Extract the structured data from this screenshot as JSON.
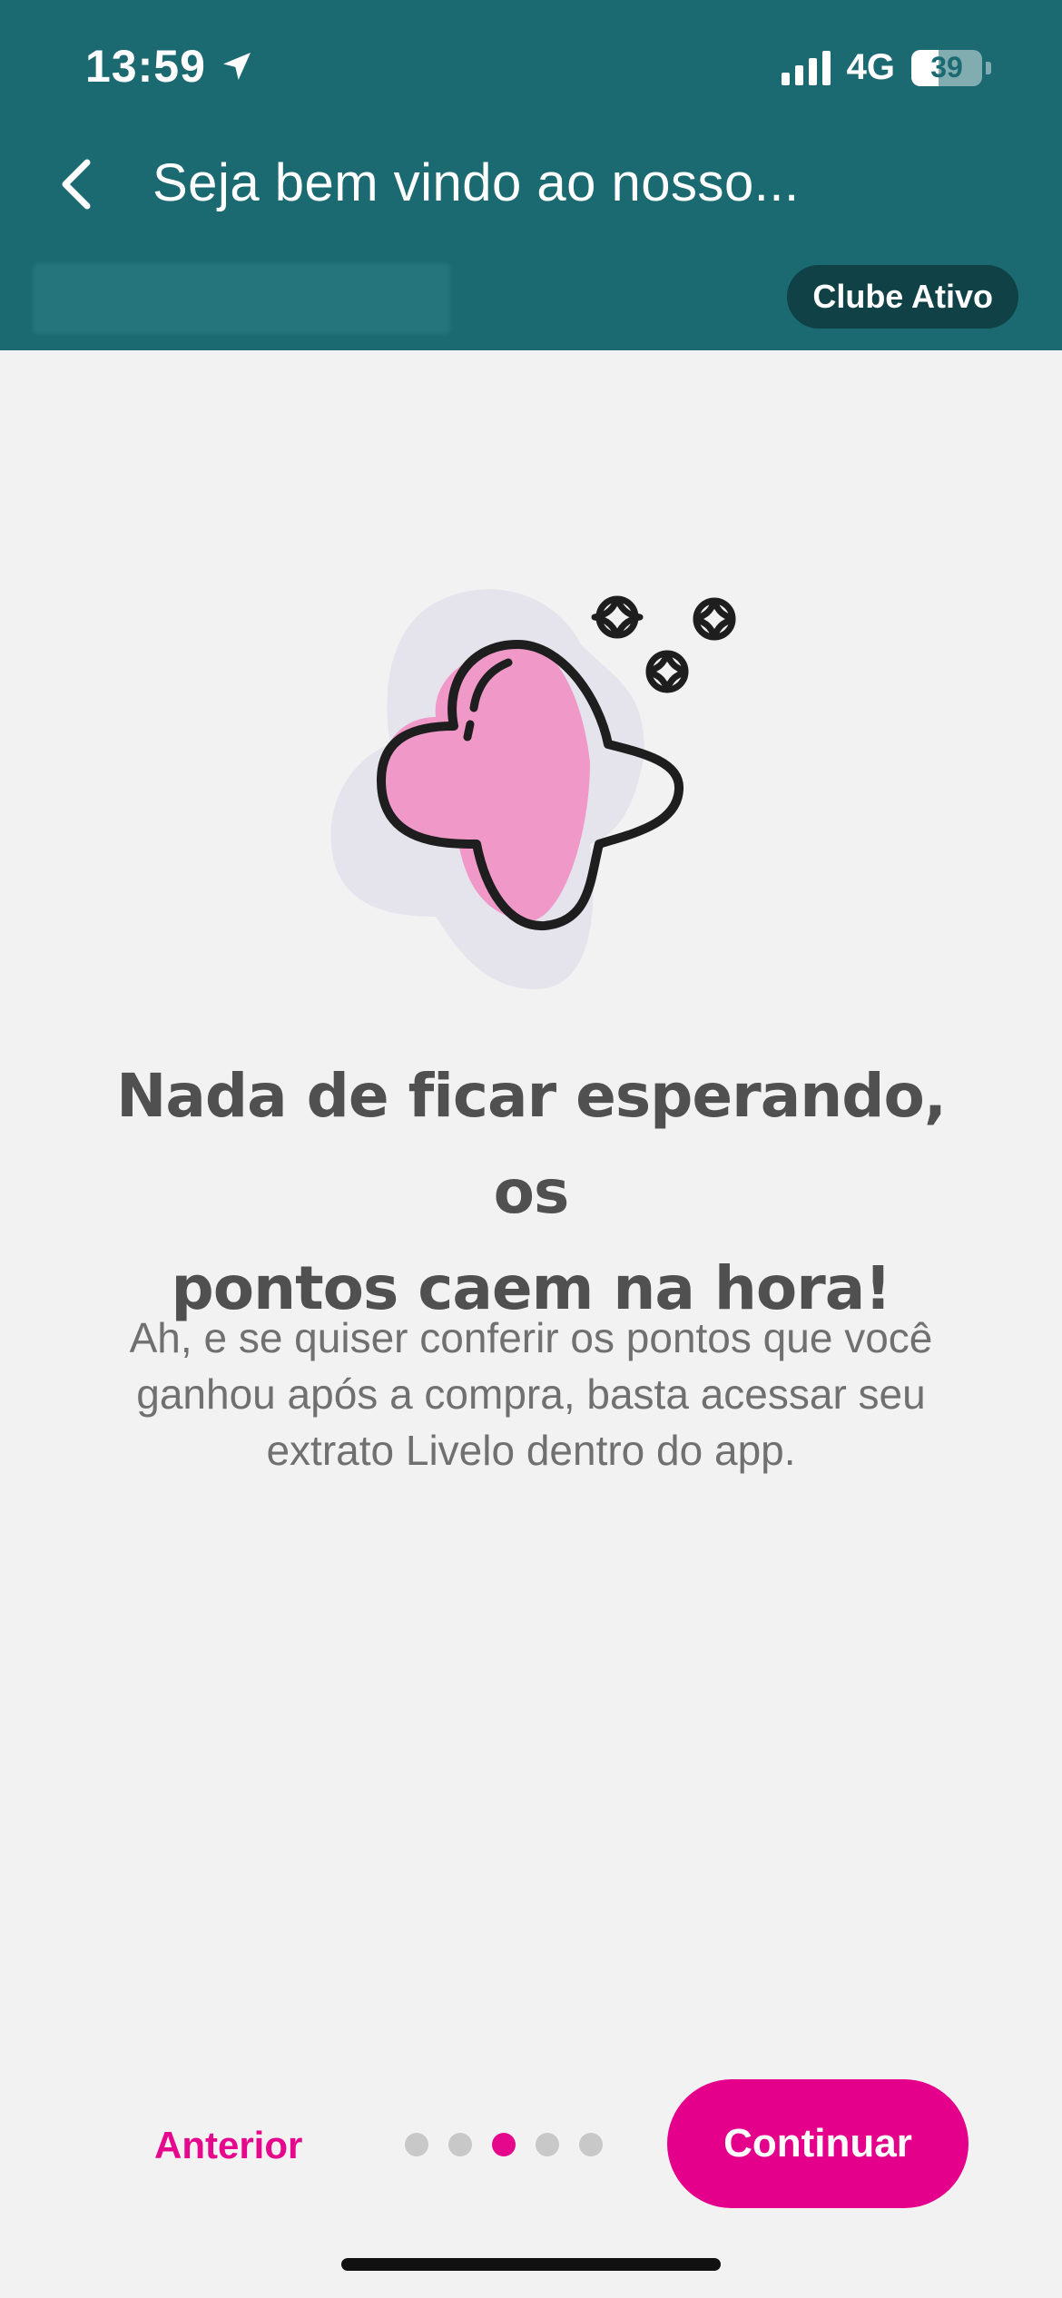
{
  "status_bar": {
    "time": "13:59",
    "network": "4G",
    "battery": "39",
    "battery_level": 0.39
  },
  "nav": {
    "title": "Seja bem vindo ao nosso..."
  },
  "header": {
    "badge": "Clube Ativo"
  },
  "content": {
    "title_line1": "Nada de ficar esperando, os",
    "title_line2": "pontos caem na hora!",
    "description": "Ah, e se quiser conferir os pontos que você ganhou após a compra, basta acessar seu extrato Livelo dentro do app."
  },
  "footer": {
    "previous_label": "Anterior",
    "continue_label": "Continuar",
    "page_total": 5,
    "page_current": 3
  },
  "colors": {
    "header": "#1b6a72",
    "accent": "#e5008b",
    "badge": "#0f4146"
  }
}
